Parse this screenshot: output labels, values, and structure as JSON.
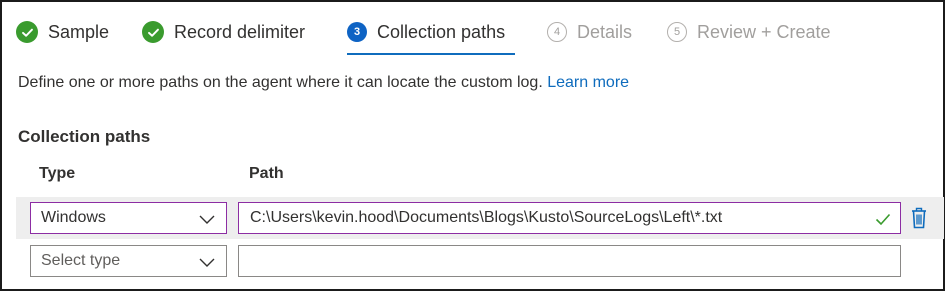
{
  "tabs": [
    {
      "label": "Sample",
      "state": "done"
    },
    {
      "label": "Record delimiter",
      "state": "done"
    },
    {
      "label": "Collection paths",
      "state": "active",
      "number": "3"
    },
    {
      "label": "Details",
      "state": "disabled",
      "number": "4"
    },
    {
      "label": "Review + Create",
      "state": "disabled",
      "number": "5"
    }
  ],
  "description": {
    "text": "Define one or more paths on the agent where it can locate the custom log.",
    "link": "Learn more"
  },
  "section_title": "Collection paths",
  "columns": {
    "type": "Type",
    "path": "Path"
  },
  "rows": [
    {
      "type": "Windows",
      "path": "C:\\Users\\kevin.hood\\Documents\\Blogs\\Kusto\\SourceLogs\\Left\\*.txt",
      "valid": true
    },
    {
      "type_placeholder": "Select type",
      "path": ""
    }
  ],
  "icons": {
    "check": "check-icon",
    "chevron": "chevron-down-icon",
    "delete": "trash-icon",
    "valid": "checkmark-icon"
  },
  "colors": {
    "accent": "#0f6cbd",
    "success": "#3a9b2e",
    "focus_border": "#8c2da3",
    "row_highlight": "#eeeeee"
  }
}
